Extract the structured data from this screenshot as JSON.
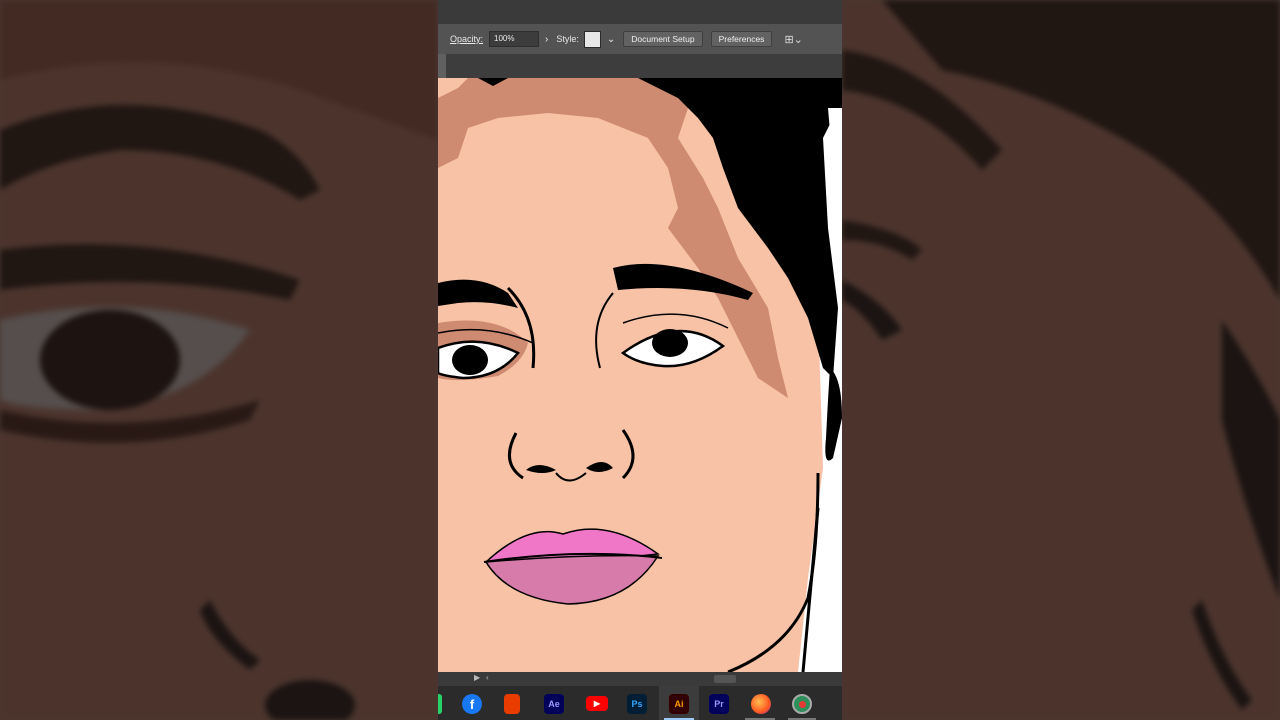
{
  "control_bar": {
    "opacity_label": "Opacity:",
    "opacity_value": "100%",
    "style_label": "Style:",
    "document_setup": "Document Setup",
    "preferences": "Preferences"
  },
  "taskbar": {
    "apps": [
      {
        "name": "facebook",
        "label": "f",
        "color": "#1877f2"
      },
      {
        "name": "office",
        "label": "",
        "color": "#eb3c00"
      },
      {
        "name": "after-effects",
        "label": "Ae",
        "color": "#00005b"
      },
      {
        "name": "youtube",
        "label": "▶",
        "color": "#ff0000"
      },
      {
        "name": "photoshop",
        "label": "Ps",
        "color": "#001e36"
      },
      {
        "name": "illustrator",
        "label": "Ai",
        "color": "#330000"
      },
      {
        "name": "premiere",
        "label": "Pr",
        "color": "#00005b"
      },
      {
        "name": "firefox",
        "label": "",
        "color": "#ff7139"
      },
      {
        "name": "screen-recorder",
        "label": "",
        "color": "#2d8f5a"
      }
    ]
  },
  "colors": {
    "skin": "#f7c2a6",
    "skin_shadow": "#cf8a72",
    "hair": "#000000",
    "lip_upper": "#f077c8",
    "lip_lower": "#d77bab",
    "ui_dark": "#535353",
    "background_blur": "#4a3730"
  }
}
